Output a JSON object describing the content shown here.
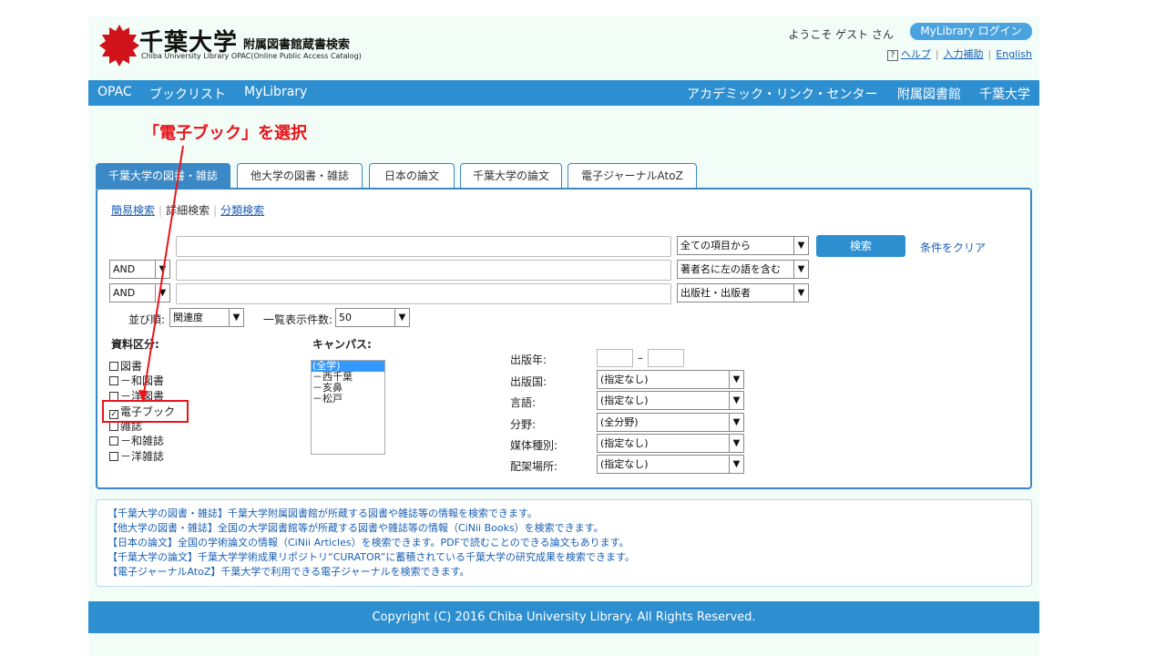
{
  "header": {
    "title": "千葉大学",
    "subtitle": "附属図書館蔵書検索",
    "english": "Chiba University Library OPAC(Online Public Access Catalog)",
    "welcome": "ようこそ ゲスト さん",
    "login": "MyLibrary ログイン",
    "help_mark": "?",
    "help": "ヘルプ",
    "input_help": "入力補助",
    "english_link": "English"
  },
  "nav": {
    "left": [
      "OPAC",
      "ブックリスト",
      "MyLibrary"
    ],
    "right": [
      "アカデミック・リンク・センター",
      "附属図書館",
      "千葉大学"
    ]
  },
  "annotation": {
    "text": "「電子ブック」を選択",
    "color": "#e8141b"
  },
  "tabs": [
    "千葉大学の図書・雑誌",
    "他大学の図書・雑誌",
    "日本の論文",
    "千葉大学の論文",
    "電子ジャーナルAtoZ"
  ],
  "subtabs": {
    "simple": "簡易検索",
    "detail": "詳細検索",
    "classify": "分類検索"
  },
  "search": {
    "field1_select": "全ての項目から",
    "field2_op": "AND",
    "field2_select": "著者名に左の語を含む",
    "field3_op": "AND",
    "field3_select": "出版社・出版者",
    "button": "検索",
    "clear": "条件をクリア",
    "sort_label": "並び順:",
    "sort_value": "関連度",
    "count_label": "一覧表示件数:",
    "count_value": "50"
  },
  "material": {
    "label": "資料区分:",
    "items": [
      {
        "label": "図書",
        "checked": false
      },
      {
        "label": "－和図書",
        "checked": false
      },
      {
        "label": "－洋図書",
        "checked": false
      },
      {
        "label": "電子ブック",
        "checked": true
      },
      {
        "label": "雑誌",
        "checked": false
      },
      {
        "label": "－和雑誌",
        "checked": false
      },
      {
        "label": "－洋雑誌",
        "checked": false
      }
    ]
  },
  "campus": {
    "label": "キャンパス:",
    "options": [
      "(全学)",
      "－西千葉",
      "－亥鼻",
      "－松戸"
    ]
  },
  "filters": {
    "year_label": "出版年:",
    "year_dash": "–",
    "country_label": "出版国:",
    "country_value": "(指定なし)",
    "lang_label": "言語:",
    "lang_value": "(指定なし)",
    "field_label": "分野:",
    "field_value": "(全分野)",
    "media_label": "媒体種別:",
    "media_value": "(指定なし)",
    "location_label": "配架場所:",
    "location_value": "(指定なし)"
  },
  "info_lines": [
    "【千葉大学の図書・雑誌】千葉大学附属図書館が所蔵する図書や雑誌等の情報を検索できます。",
    "【他大学の図書・雑誌】全国の大学図書館等が所蔵する図書や雑誌等の情報（CiNii Books）を検索できます。",
    "【日本の論文】全国の学術論文の情報（CiNii Articles）を検索できます。PDFで読むことのできる論文もあります。",
    "【千葉大学の論文】千葉大学学術成果リポジトリ“CURATOR”に蓄積されている千葉大学の研究成果を検索できます。",
    "【電子ジャーナルAtoZ】千葉大学で利用できる電子ジャーナルを検索できます。"
  ],
  "footer": "Copyright (C) 2016 Chiba University Library. All Rights Reserved.",
  "colors": {
    "accent": "#2e8fd0",
    "annotation": "#e8141b",
    "background": "#f3fdf8"
  }
}
